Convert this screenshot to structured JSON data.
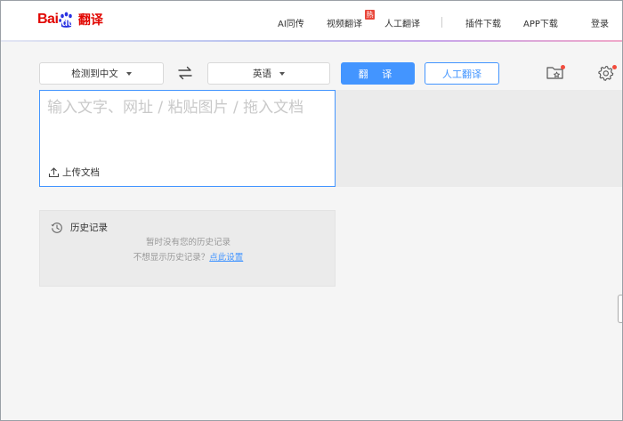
{
  "header": {
    "logo": {
      "part1": "Bai",
      "part2": "du",
      "part3": "翻译"
    },
    "nav": {
      "ai_simul": "AI同传",
      "video_translate": "视频翻译",
      "hot_badge": "热",
      "human_translate": "人工翻译",
      "plugin_download": "插件下载",
      "app_download": "APP下载",
      "login": "登录"
    }
  },
  "toolbar": {
    "source_lang": "检测到中文",
    "target_lang": "英语",
    "translate_button": "翻 译",
    "human_translate_button": "人工翻译"
  },
  "input": {
    "placeholder": "输入文字、网址 / 粘贴图片 / 拖入文档",
    "upload_label": "上传文档"
  },
  "history": {
    "title": "历史记录",
    "empty_text": "暂时没有您的历史记录",
    "tip_text": "不想显示历史记录？",
    "tip_link": "点此设置"
  },
  "colors": {
    "accent": "#4395ff",
    "brand_red": "#e10601",
    "brand_blue": "#2932e1",
    "badge_red": "#e9473b"
  }
}
